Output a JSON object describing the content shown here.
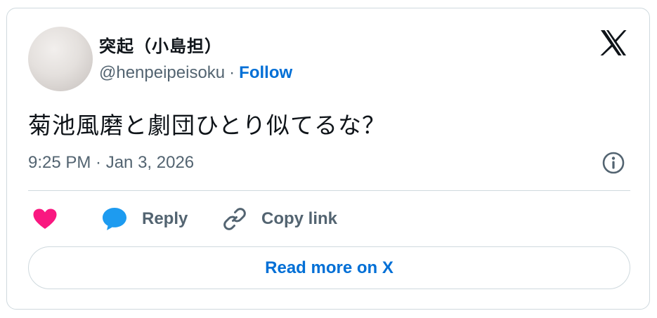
{
  "author": {
    "display_name": "突起（小島担）",
    "handle": "@henpeipeisoku",
    "separator": "·",
    "follow_label": "Follow"
  },
  "tweet": {
    "text": "菊池風磨と劇団ひとり似てるな？",
    "timestamp": "9:25 PM · Jan 3, 2026"
  },
  "actions": {
    "reply_label": "Reply",
    "copy_label": "Copy link"
  },
  "read_more_label": "Read more on X",
  "icons": {
    "brand": "x-logo-icon",
    "info": "info-icon",
    "like": "heart-icon",
    "reply": "speech-bubble-icon",
    "copy": "link-icon"
  },
  "colors": {
    "accent": "#006fd6",
    "like": "#f91880",
    "reply": "#1d9bf0",
    "muted": "#536471",
    "border": "#cfd9de"
  }
}
